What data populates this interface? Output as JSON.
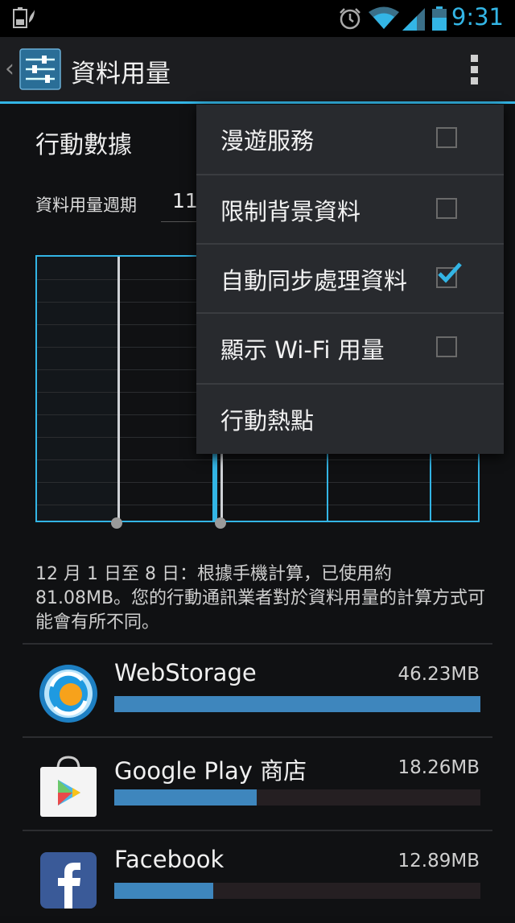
{
  "status_bar": {
    "time": "9:31",
    "icons": [
      "battery-saver-icon",
      "alarm-icon",
      "wifi-icon",
      "signal-icon",
      "battery-icon"
    ]
  },
  "action_bar": {
    "title": "資料用量",
    "icons": [
      "back-chevron-icon",
      "settings-icon",
      "overflow-menu-icon"
    ]
  },
  "main": {
    "mobile_data_label": "行動數據",
    "cycle_label": "資料用量週期",
    "cycle_value": "11"
  },
  "summary": "12 月 1 日至 8 日：根據手機計算，已使用約 81.08MB。您的行動通訊業者對於資料用量的計算方式可能會有所不同。",
  "apps": [
    {
      "name": "WebStorage",
      "size": "46.23MB",
      "fraction": 1.0,
      "icon": "webstorage-icon"
    },
    {
      "name": "Google Play 商店",
      "size": "18.26MB",
      "fraction": 0.39,
      "icon": "google-play-store-icon"
    },
    {
      "name": "Facebook",
      "size": "12.89MB",
      "fraction": 0.27,
      "icon": "facebook-icon"
    }
  ],
  "menu": {
    "items": [
      {
        "label": "漫遊服務",
        "checkbox": true,
        "checked": false
      },
      {
        "label": "限制背景資料",
        "checkbox": true,
        "checked": false
      },
      {
        "label": "自動同步處理資料",
        "checkbox": true,
        "checked": true
      },
      {
        "label": "顯示 Wi-Fi 用量",
        "checkbox": true,
        "checked": false
      },
      {
        "label": "行動熱點",
        "checkbox": false,
        "checked": false
      }
    ]
  },
  "colors": {
    "accent": "#33b5e5",
    "bar_fill": "#3e86bd",
    "menu_bg": "#282a2e"
  }
}
